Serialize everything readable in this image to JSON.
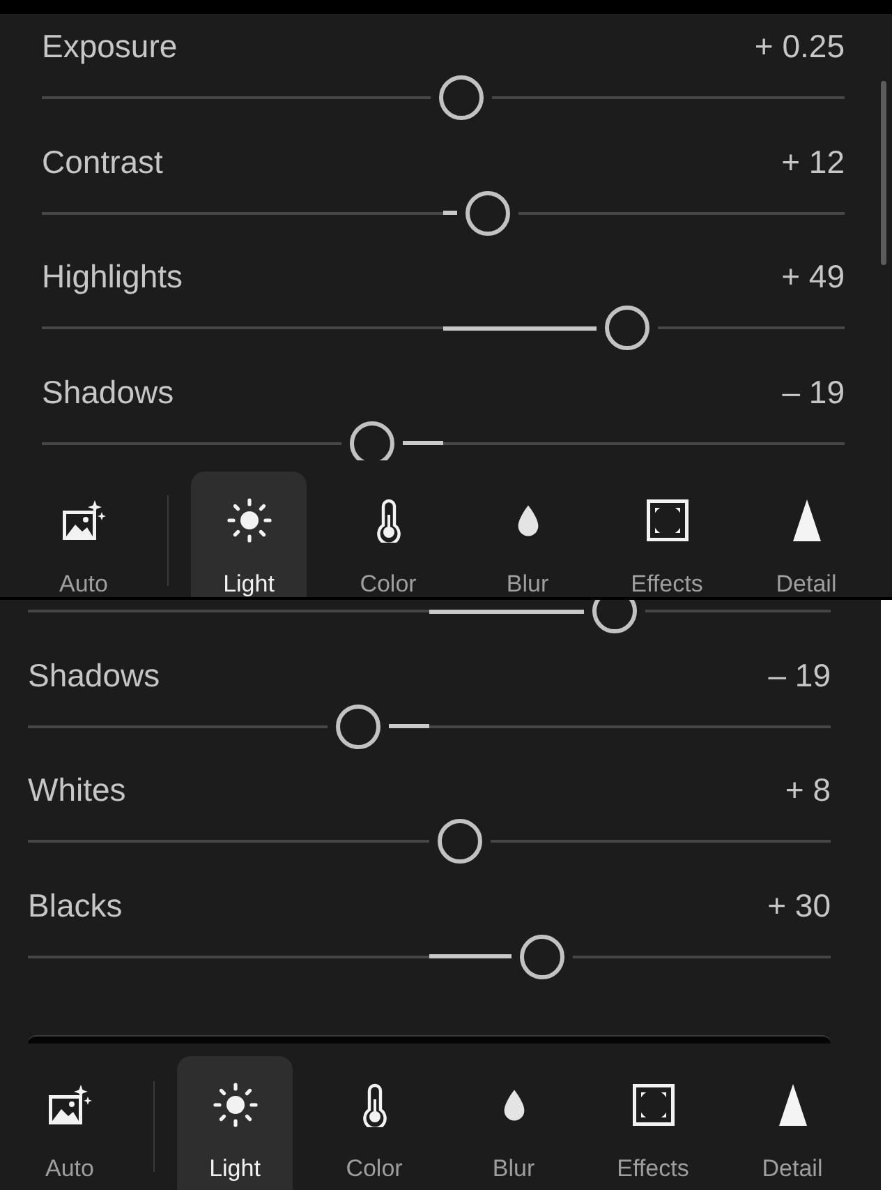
{
  "screens": [
    {
      "sliders": [
        {
          "label": "Exposure",
          "value": "+ 0.25",
          "level": 0.523
        },
        {
          "label": "Contrast",
          "value": "+ 12",
          "level": 0.556
        },
        {
          "label": "Highlights",
          "value": "+ 49",
          "level": 0.729
        },
        {
          "label": "Shadows",
          "value": "– 19",
          "level": 0.411
        }
      ],
      "auto_button": {
        "label": "Auto"
      },
      "tabs": [
        {
          "label": "Light",
          "selected": true
        },
        {
          "label": "Color",
          "selected": false
        },
        {
          "label": "Blur",
          "selected": false
        },
        {
          "label": "Effects",
          "selected": false
        },
        {
          "label": "Detail",
          "selected": false
        }
      ]
    },
    {
      "clipped_slider": {
        "level": 0.731
      },
      "sliders": [
        {
          "label": "Shadows",
          "value": "– 19",
          "level": 0.411
        },
        {
          "label": "Whites",
          "value": "+ 8",
          "level": 0.538
        },
        {
          "label": "Blacks",
          "value": "+ 30",
          "level": 0.641
        }
      ],
      "auto_button": {
        "label": "Auto"
      },
      "tabs": [
        {
          "label": "Light",
          "selected": true
        },
        {
          "label": "Color",
          "selected": false
        },
        {
          "label": "Blur",
          "selected": false
        },
        {
          "label": "Effects",
          "selected": false
        },
        {
          "label": "Detail",
          "selected": false
        }
      ]
    }
  ]
}
